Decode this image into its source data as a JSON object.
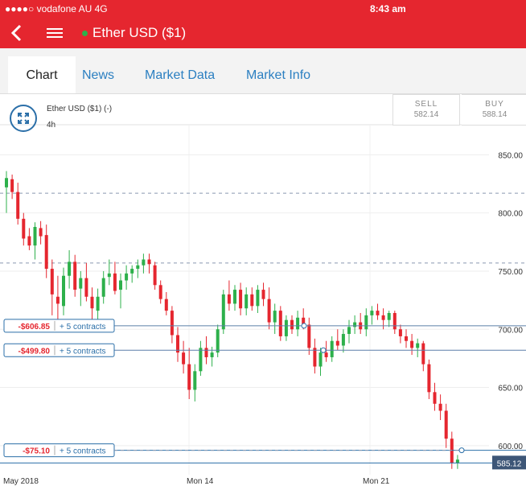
{
  "status_bar": {
    "carrier": "●●●●○ vodafone AU  4G",
    "time": "8:43 am"
  },
  "header": {
    "title": "Ether USD ($1)",
    "status_color": "#2db04b"
  },
  "tabs": [
    {
      "label": "Chart",
      "active": true
    },
    {
      "label": "News",
      "active": false
    },
    {
      "label": "Market Data",
      "active": false
    },
    {
      "label": "Market Info",
      "active": false
    }
  ],
  "instrument": {
    "name": "Ether USD ($1) (-)",
    "period": "4h"
  },
  "prices": {
    "sell_label": "SELL",
    "sell": "582.14",
    "buy_label": "BUY",
    "buy": "588.14"
  },
  "chart_data": {
    "type": "candlestick",
    "yticks": [
      "850.00",
      "800.00",
      "750.00",
      "700.00",
      "650.00",
      "600.00"
    ],
    "xticks": [
      "May 2018",
      "Mon 14",
      "Mon 21"
    ],
    "current_price": "585.12",
    "positions": [
      {
        "pnl": "-$606.85",
        "contracts": "+ 5 contracts",
        "level": 703
      },
      {
        "pnl": "-$499.80",
        "contracts": "+ 5 contracts",
        "level": 682
      },
      {
        "pnl": "-$75.10",
        "contracts": "+ 5 contracts",
        "level": 596
      }
    ],
    "up_color": "#2db04b",
    "down_color": "#e5262f",
    "ylim": [
      575,
      862
    ]
  }
}
